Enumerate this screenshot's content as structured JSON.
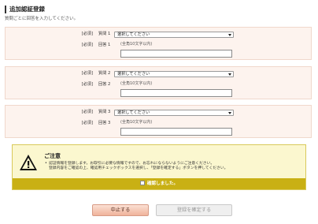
{
  "page": {
    "title": "追加認証登録",
    "subtitle": "質問ごとに回答を入力してください。"
  },
  "questions": [
    {
      "required": "[必須]",
      "question_label": "質問 1",
      "select_value": "選択してください",
      "answer_label": "回答 1",
      "hint": "(全角10文字以内)",
      "answer_value": ""
    },
    {
      "required": "[必須]",
      "question_label": "質問 2",
      "select_value": "選択してください",
      "answer_label": "回答 2",
      "hint": "(全角10文字以内)",
      "answer_value": ""
    },
    {
      "required": "[必須]",
      "question_label": "質問 3",
      "select_value": "選択してください",
      "answer_label": "回答 3",
      "hint": "(全角10文字以内)",
      "answer_value": ""
    }
  ],
  "caution": {
    "title": "ご注意",
    "line1": "認証情報を登録します。お取引に必要な情報ですので、お忘れにならないようにご注意ください。",
    "line2": "登録内容をご確認の上、確認用チェックボックスを選択し、「登録を確定する」ボタンを押してください。",
    "confirm_label": "確認しました。"
  },
  "buttons": {
    "cancel": "中止する",
    "confirm": "登録を確定する"
  },
  "colors": {
    "question_bg": "#fdf3ee",
    "caution_bg": "#fbf7cf",
    "confirm_bar": "#c9b014",
    "cancel_button": "#f6c6b2"
  }
}
